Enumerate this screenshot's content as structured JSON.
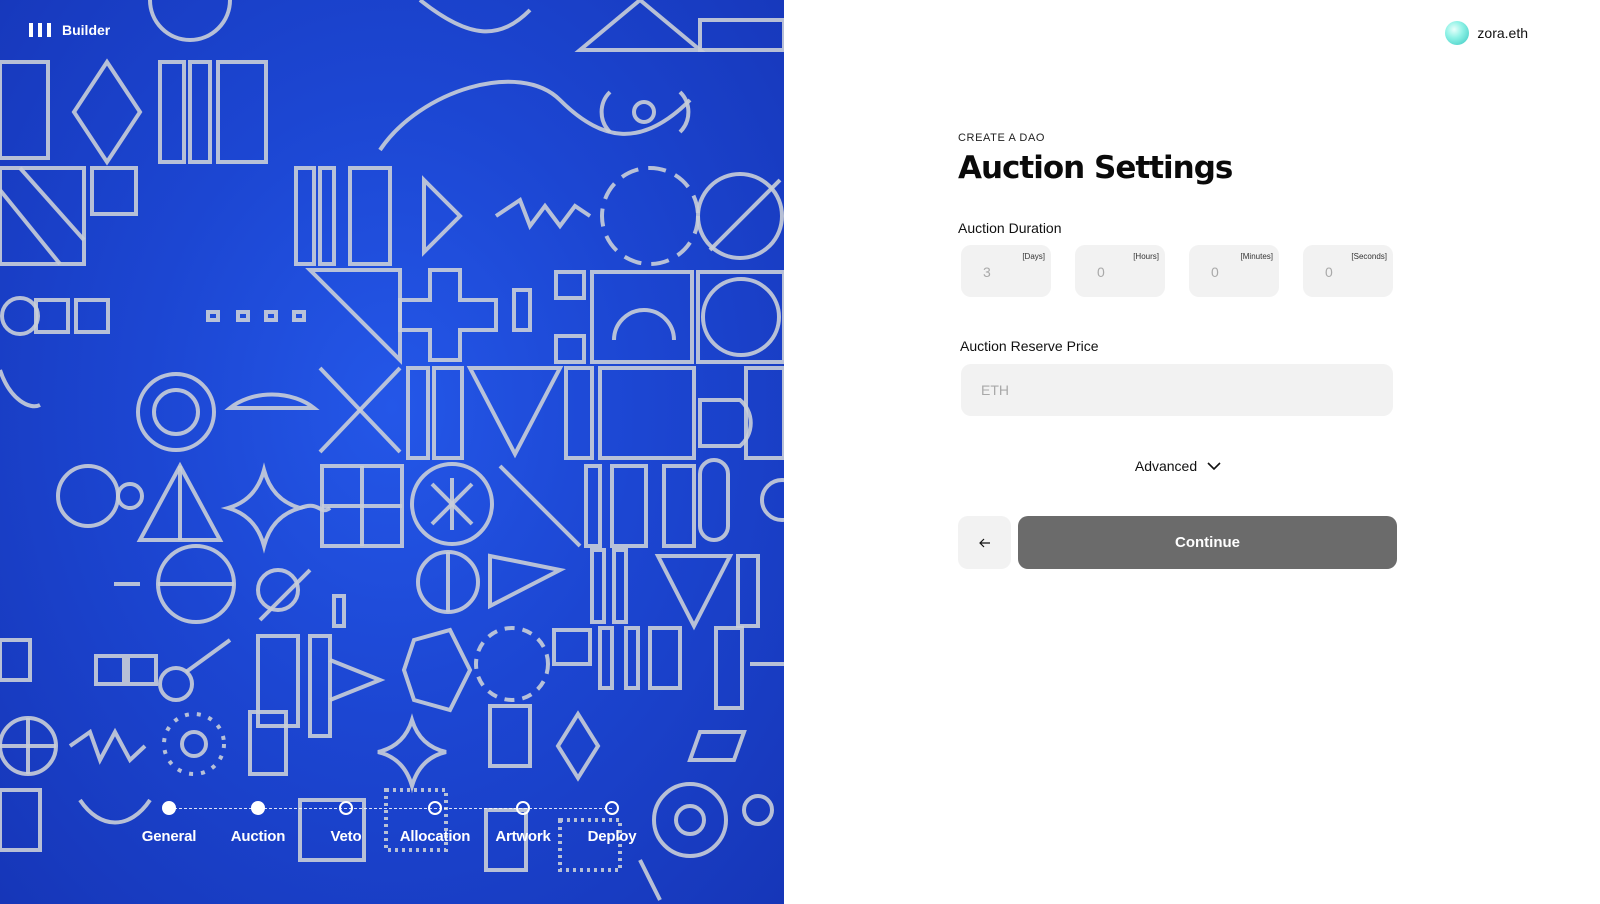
{
  "app": {
    "brand_label": "Builder",
    "brand_icon": "builder-logo-icon"
  },
  "account": {
    "name": "zora.eth",
    "avatar_color": "#5fe0d6"
  },
  "stepper": {
    "current_index": 1,
    "steps": [
      {
        "label": "General",
        "state": "done"
      },
      {
        "label": "Auction",
        "state": "done"
      },
      {
        "label": "Veto",
        "state": "pending"
      },
      {
        "label": "Allocation",
        "state": "pending"
      },
      {
        "label": "Artwork",
        "state": "pending"
      },
      {
        "label": "Deploy",
        "state": "pending"
      }
    ]
  },
  "form": {
    "eyebrow": "CREATE A DAO",
    "title": "Auction Settings",
    "duration": {
      "label": "Auction Duration",
      "fields": [
        {
          "unit": "[Days]",
          "value": "3"
        },
        {
          "unit": "[Hours]",
          "value": "0"
        },
        {
          "unit": "[Minutes]",
          "value": "0"
        },
        {
          "unit": "[Seconds]",
          "value": "0"
        }
      ]
    },
    "reserve_price": {
      "label": "Auction Reserve Price",
      "placeholder": "ETH",
      "value": ""
    },
    "advanced_label": "Advanced",
    "back_icon": "arrow-left-icon",
    "continue_label": "Continue"
  },
  "colors": {
    "art_background": "#1c46d2",
    "art_lines": "#c9ced8",
    "input_background": "#f2f2f2",
    "continue_button": "#6b6b6b"
  }
}
